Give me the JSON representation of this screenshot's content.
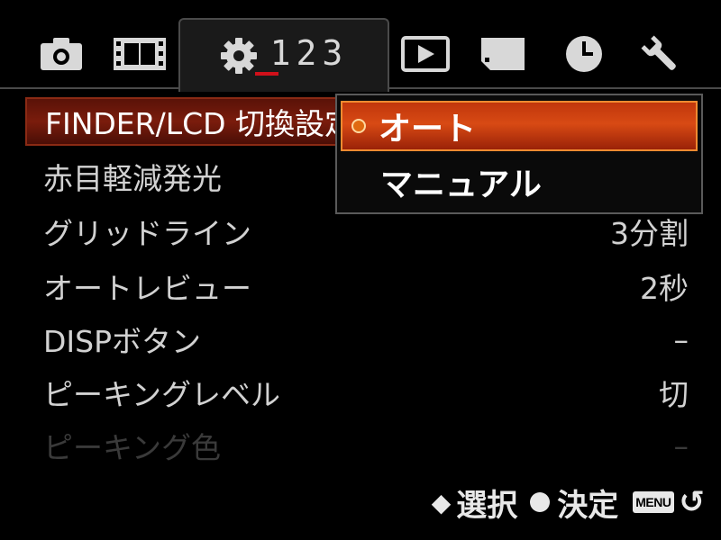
{
  "tabs": {
    "icons": [
      "camera-icon",
      "movie-icon",
      "gear-icon",
      "play-icon",
      "memory-card-icon",
      "clock-icon",
      "wrench-icon"
    ],
    "active": "gear-icon",
    "settings_pages": "123",
    "active_page": "1"
  },
  "menu": {
    "items": [
      {
        "label": "FINDER/LCD 切換設定",
        "value": ""
      },
      {
        "label": "赤目軽減発光",
        "value": ""
      },
      {
        "label": "グリッドライン",
        "value": "3分割"
      },
      {
        "label": "オートレビュー",
        "value": "2秒"
      },
      {
        "label": "DISPボタン",
        "value": "–"
      },
      {
        "label": "ピーキングレベル",
        "value": "切"
      },
      {
        "label": "ピーキング色",
        "value": "–"
      }
    ],
    "selected_index": 0
  },
  "popup": {
    "options": [
      "オート",
      "マニュアル"
    ],
    "selected_index": 0
  },
  "footer": {
    "updown_glyph": "◆",
    "select_label": "選択",
    "enter_label": "決定",
    "menu_button": "MENU",
    "back_glyph": "↺"
  },
  "colors": {
    "accent_red": "#d0101a",
    "selected_row": "#7a1c0c",
    "selected_option": "#d84a14"
  }
}
